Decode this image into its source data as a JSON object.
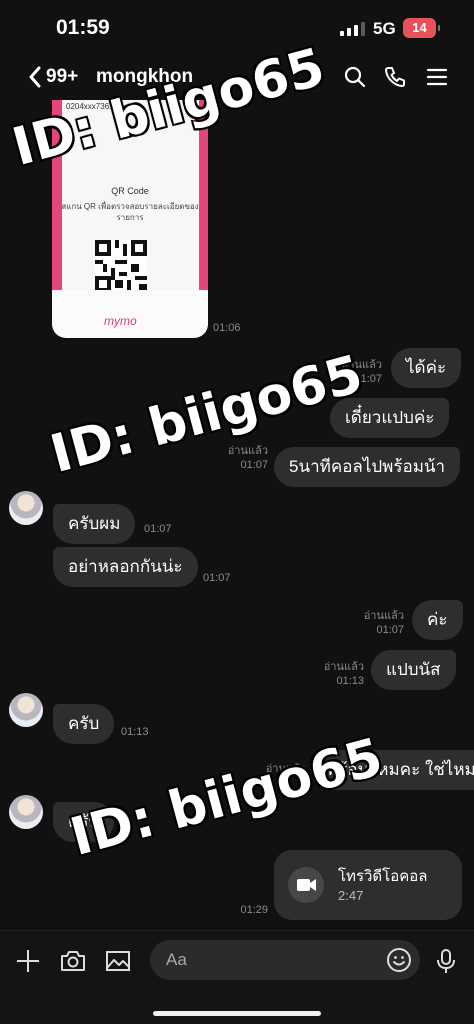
{
  "status": {
    "time": "01:59",
    "network": "5G",
    "battery": "14"
  },
  "header": {
    "unread_count": "99+",
    "contact_name": "mongkhon"
  },
  "image_message": {
    "account_number": "0204xxx7361",
    "qr_title": "QR Code",
    "qr_caption": "สแกน QR เพื่อตรวจสอบรายละเอียดของรายการ",
    "brand": "mymo",
    "time": "01:06"
  },
  "messages": [
    {
      "side": "right",
      "text": "ได้ค่ะ",
      "read": "อ่านแล้ว",
      "time": "01:07"
    },
    {
      "side": "right",
      "text": "เดี๋ยวแปบค่ะ",
      "read": "",
      "time": ""
    },
    {
      "side": "right",
      "text": "5นาทีคอลไปพร้อมน้า",
      "read": "อ่านแล้ว",
      "time": "01:07"
    },
    {
      "side": "left",
      "text": "ครับผม",
      "time": "01:07"
    },
    {
      "side": "left",
      "text": "อย่าหลอกกันน่ะ",
      "time": "01:07"
    },
    {
      "side": "right",
      "text": "ค่ะ",
      "read": "อ่านแล้ว",
      "time": "01:07"
    },
    {
      "side": "right",
      "text": "แปบนัส",
      "read": "อ่านแล้ว",
      "time": "01:13"
    },
    {
      "side": "left",
      "text": "ครับ",
      "time": "01:13"
    },
    {
      "side": "right",
      "text": "พร้อมไหมคะ ใช่ไหมคะ เปล่า",
      "read": "อ่านแล้ว",
      "time": ""
    },
    {
      "side": "left",
      "text": "ครับ",
      "time": ""
    }
  ],
  "video_call": {
    "label": "โทรวิดีโอคอล",
    "duration": "2:47",
    "time": "01:29"
  },
  "watermark": "ID: biigo65",
  "composer": {
    "placeholder": "Aa"
  }
}
